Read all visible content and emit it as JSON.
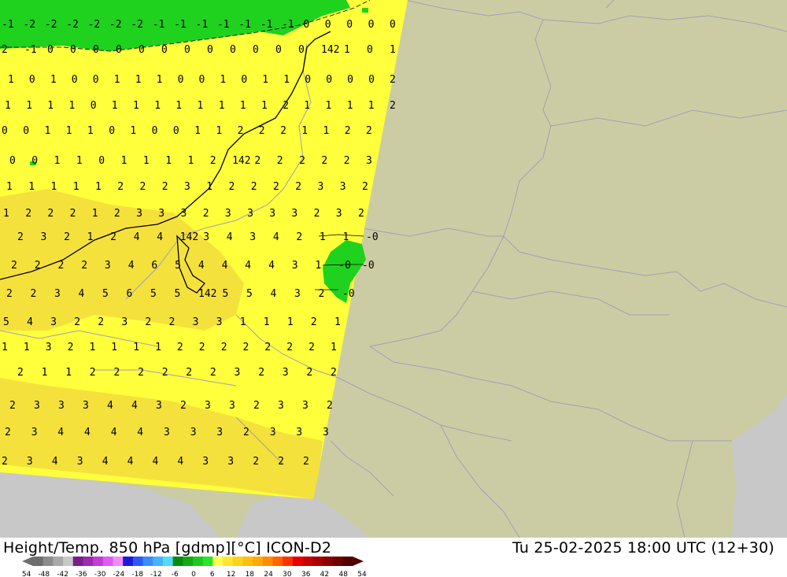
{
  "footer": {
    "title": "Height/Temp. 850 hPa [gdmp][°C] ICON-D2",
    "datetime": "Tu 25-02-2025 18:00 UTC (12+30)"
  },
  "colorbar": {
    "ticks": [
      "-54",
      "-48",
      "-42",
      "-36",
      "-30",
      "-24",
      "-18",
      "-12",
      "-6",
      "0",
      "6",
      "12",
      "18",
      "24",
      "30",
      "36",
      "42",
      "48",
      "54"
    ],
    "colors": [
      "#6e6e6e",
      "#8c8c8c",
      "#a9a9a9",
      "#c8c8c8",
      "#7a1d8a",
      "#9b2bb0",
      "#bf3ed6",
      "#e05cf0",
      "#f08cf8",
      "#1a1ad6",
      "#2a5af0",
      "#3c8cf8",
      "#46b4fa",
      "#50dcfa",
      "#0a8c0a",
      "#14aa14",
      "#1ec81e",
      "#28e628",
      "#ffff50",
      "#ffe632",
      "#ffd21e",
      "#ffbe14",
      "#ffaa0a",
      "#ff8c00",
      "#ff6400",
      "#ff3200",
      "#e60000",
      "#c80000",
      "#aa0000",
      "#8c0000",
      "#6e0000",
      "#500000"
    ]
  },
  "colors": {
    "land": "#cccca4",
    "sea": "#c8c8c8",
    "yellow": "#ffff3c",
    "orange": "#f5e13c",
    "green": "#1ed21e",
    "border": "#9ea0b4"
  },
  "contour_labels": [
    "142",
    "142",
    "142",
    "142",
    "142"
  ],
  "grid_values": [
    "-1 -2 -2 -2 -2 -2 -2 -1 -1 -1 -1 -1 -1 -1 0 0 0 0 0",
    "2 -1 0 0 0 0 0 0 0 0 0 0 0 0 142 1 0 1",
    "1 0 1 0 0 1 1 1 0 0 1 0 1 1 0 0 0 0 2",
    "1 1 1 1 0 1 1 1 1 1 1 1 1 2 1 1 1 1 2",
    "0 0 1 1 1 0 1 0 0 1 1 2 2 2 1 1 2 2",
    "0 0 1 1 0 1 1 1 1 2 142 2 2 2 2 2 3",
    "1 1 1 1 1 2 2 2 3 1 2 2 2 2 3 3 2",
    "1 2 2 2 1 2 3 3 3 2 3 3 3 3 2 3 2",
    "2 3 2 1 2 4 4 142 3 4 3 4 2 1 1 -0",
    "2 2 2 2 3 4 6 5 4 4 4 4 3 1 -0 -0",
    "2 2 3 4 5 6 5 5 142 5 5 4 3 2 -0",
    "5 4 3 2 2 3 2 2 3 3 1 1 1 2 1",
    "1 1 3 2 1 1 1 1 2 2 2 2 2 2 2 1",
    "2 1 1 2 2 2 2 2 2 3 2 3 2 2",
    "2 3 3 3 4 4 3 2 3 3 2 3 3 2",
    "2 3 4 4 4 4 3 3 3 2 3 3 3",
    "2 3 4 3 4 4 4 4 3 3 2 2 2"
  ]
}
